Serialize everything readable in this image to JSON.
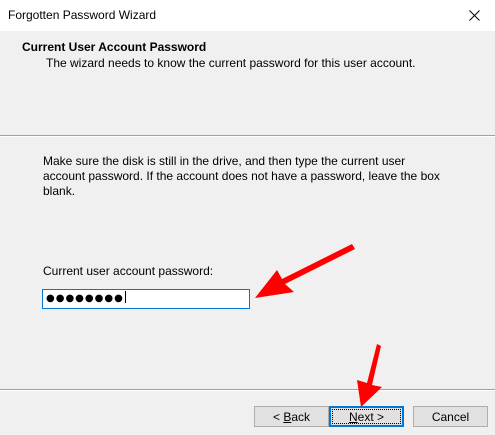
{
  "window": {
    "title": "Forgotten Password Wizard"
  },
  "header": {
    "title": "Current User Account Password",
    "subtitle": "The wizard needs to know the current password for this user account."
  },
  "main": {
    "instructions": "Make sure the disk is still in the drive, and then type the current user account password. If the account does not have a password, leave the box blank.",
    "password_label": "Current user account password:",
    "password_value_masked": "●●●●●●●●"
  },
  "buttons": {
    "back_prefix": "< ",
    "back_mnemonic": "B",
    "back_rest": "ack",
    "next_mnemonic": "N",
    "next_rest": "ext >",
    "cancel": "Cancel"
  },
  "icons": {
    "close": "close-icon",
    "annotation_arrow": "red-arrow-icon"
  },
  "colors": {
    "focus_blue": "#0078d7",
    "annotation_red": "#ff0000",
    "dialog_bg": "#f0f0f0"
  }
}
